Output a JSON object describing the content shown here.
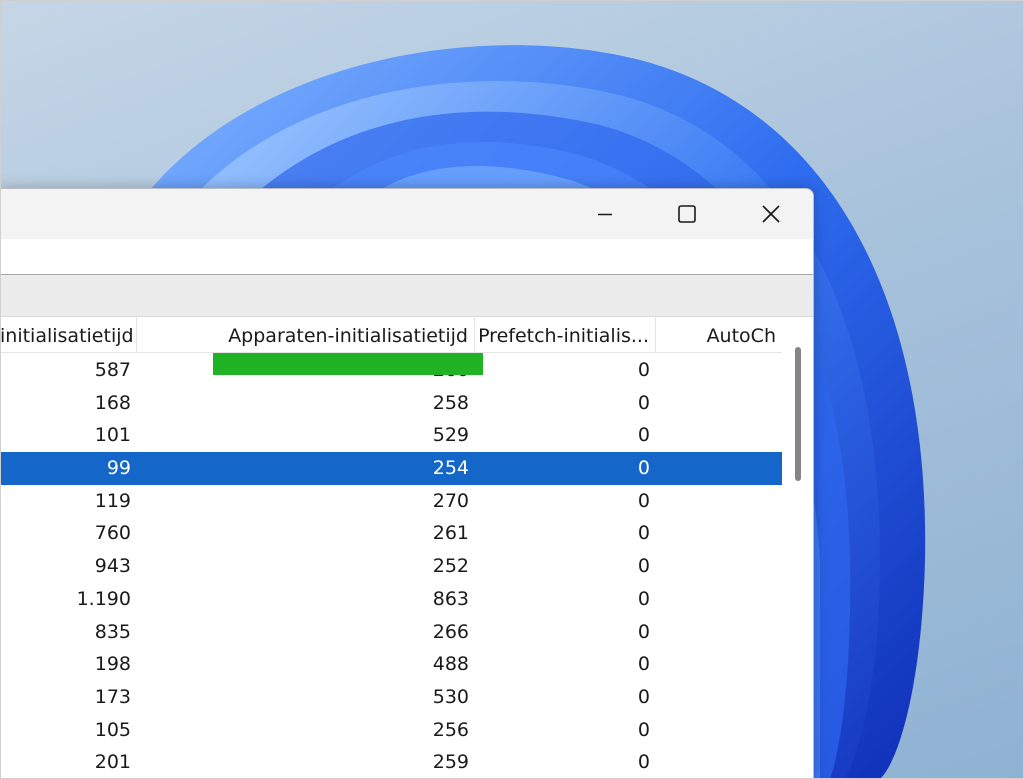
{
  "window": {
    "controls": {
      "minimize_icon": "minimize-icon",
      "maximize_icon": "maximize-icon",
      "close_icon": "close-icon"
    }
  },
  "table": {
    "columns": [
      {
        "label": "initialisatietijd"
      },
      {
        "label": "Apparaten-initialisatietijd"
      },
      {
        "label": "Prefetch-initialis..."
      },
      {
        "label": "AutoCh"
      }
    ],
    "rows": [
      {
        "c1": "587",
        "c2": "260",
        "c3": "0",
        "c4": ""
      },
      {
        "c1": "168",
        "c2": "258",
        "c3": "0",
        "c4": ""
      },
      {
        "c1": "101",
        "c2": "529",
        "c3": "0",
        "c4": ""
      },
      {
        "c1": "99",
        "c2": "254",
        "c3": "0",
        "c4": "",
        "selected": true
      },
      {
        "c1": "119",
        "c2": "270",
        "c3": "0",
        "c4": ""
      },
      {
        "c1": "760",
        "c2": "261",
        "c3": "0",
        "c4": ""
      },
      {
        "c1": "943",
        "c2": "252",
        "c3": "0",
        "c4": ""
      },
      {
        "c1": "1.190",
        "c2": "863",
        "c3": "0",
        "c4": ""
      },
      {
        "c1": "835",
        "c2": "266",
        "c3": "0",
        "c4": ""
      },
      {
        "c1": "198",
        "c2": "488",
        "c3": "0",
        "c4": ""
      },
      {
        "c1": "173",
        "c2": "530",
        "c3": "0",
        "c4": ""
      },
      {
        "c1": "105",
        "c2": "256",
        "c3": "0",
        "c4": ""
      },
      {
        "c1": "201",
        "c2": "259",
        "c3": "0",
        "c4": ""
      }
    ]
  },
  "colors": {
    "selection": "#1467c8",
    "highlight_marker": "#21b326",
    "wallpaper_accent": "#1a55e0"
  }
}
